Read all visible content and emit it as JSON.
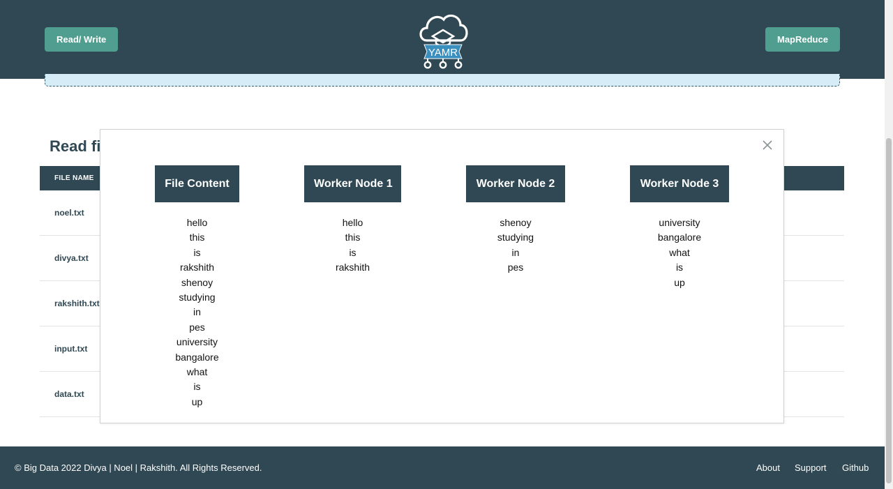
{
  "header": {
    "left_button": "Read/ Write",
    "right_button": "MapReduce",
    "logo_text": "YAMR"
  },
  "page": {
    "title": "Read fil",
    "table": {
      "column_header": "FILE NAME",
      "files": [
        "noel.txt",
        "divya.txt",
        "rakshith.txt",
        "input.txt",
        "data.txt"
      ]
    }
  },
  "modal": {
    "columns": [
      {
        "title": "File Content",
        "words": [
          "hello",
          "this",
          "is",
          "rakshith",
          "shenoy",
          "studying",
          "in",
          "pes",
          "university",
          "bangalore",
          "what",
          "is",
          "up"
        ]
      },
      {
        "title": "Worker Node 1",
        "words": [
          "hello",
          "this",
          "is",
          "rakshith"
        ]
      },
      {
        "title": "Worker Node 2",
        "words": [
          "shenoy",
          "studying",
          "in",
          "pes"
        ]
      },
      {
        "title": "Worker Node 3",
        "words": [
          "university",
          "bangalore",
          "what",
          "is",
          "up"
        ]
      }
    ]
  },
  "footer": {
    "copyright": "© Big Data 2022 Divya | Noel | Rakshith. All Rights Reserved.",
    "links": [
      "About",
      "Support",
      "Github"
    ]
  },
  "colors": {
    "primary_dark": "#2f4853",
    "accent_teal": "#4f9e8f",
    "dropzone_bg": "#d6edf7"
  }
}
